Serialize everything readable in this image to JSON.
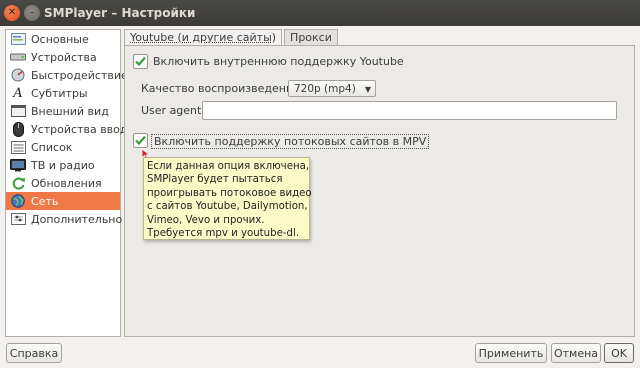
{
  "window": {
    "title": "SMPlayer – Настройки"
  },
  "sidebar": {
    "items": [
      {
        "label": "Основные",
        "icon": "general-icon"
      },
      {
        "label": "Устройства",
        "icon": "devices-icon"
      },
      {
        "label": "Быстродействие",
        "icon": "performance-icon"
      },
      {
        "label": "Субтитры",
        "icon": "subtitles-icon"
      },
      {
        "label": "Внешний вид",
        "icon": "appearance-icon"
      },
      {
        "label": "Устройства ввода",
        "icon": "input-devices-icon"
      },
      {
        "label": "Список",
        "icon": "playlist-icon"
      },
      {
        "label": "ТВ и радио",
        "icon": "tv-radio-icon"
      },
      {
        "label": "Обновления",
        "icon": "updates-icon"
      },
      {
        "label": "Сеть",
        "icon": "network-icon",
        "selected": true
      },
      {
        "label": "Дополнительно",
        "icon": "advanced-icon"
      }
    ]
  },
  "tabs": [
    {
      "label": "Youtube (и другие сайты)",
      "active": true
    },
    {
      "label": "Прокси",
      "active": false
    }
  ],
  "youtube": {
    "enable_label": "Включить внутреннюю поддержку Youtube",
    "enable_checked": true,
    "quality_label": "Качество воспроизведения",
    "quality_value": "720p (mp4)",
    "user_agent_label": "User agent",
    "user_agent_value": "",
    "mpv_label": "Включить поддержку потоковых сайтов в MPV",
    "mpv_checked": true
  },
  "tooltip": {
    "lines": [
      "Если данная опция включена,",
      "SMPlayer будет пытаться",
      "проигрывать потоковое видео",
      "с сайтов Youtube, Dailymotion,",
      "Vimeo, Vevo и прочих.",
      "Требуется mpv и youtube-dl."
    ]
  },
  "buttons": {
    "help": "Справка",
    "apply": "Применить",
    "cancel": "Отмена",
    "ok": "OK"
  },
  "colors": {
    "selected_bg": "#f07746",
    "titlebar_bg": "#3c3b37",
    "tooltip_bg": "#fcfbc8",
    "check_green": "#3a9b3a"
  }
}
